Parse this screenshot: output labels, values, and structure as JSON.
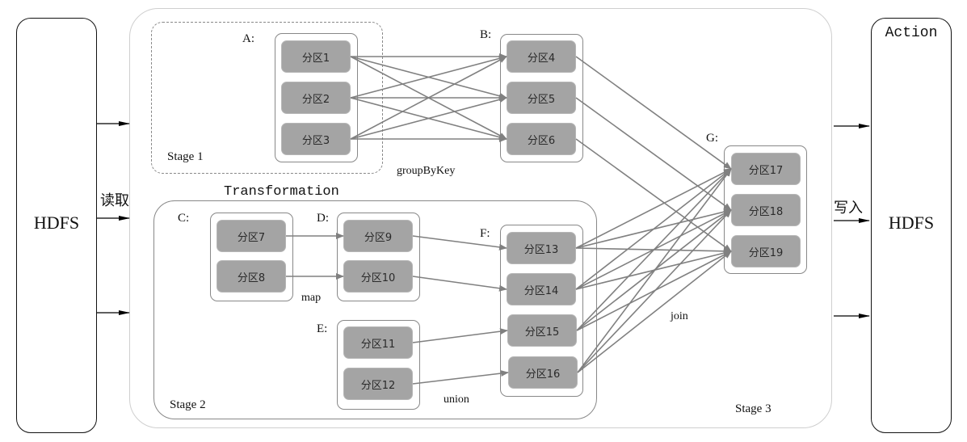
{
  "source": {
    "label": "HDFS",
    "read_label": "读取"
  },
  "sink": {
    "label": "HDFS",
    "header": "Action",
    "write_label": "写入"
  },
  "transformation_label": "Transformation",
  "stages": [
    {
      "id": "stage1",
      "label": "Stage 1"
    },
    {
      "id": "stage2",
      "label": "Stage 2"
    },
    {
      "id": "stage3",
      "label": "Stage 3"
    }
  ],
  "rdds": {
    "A": {
      "label": "A:",
      "partitions": [
        "分区1",
        "分区2",
        "分区3"
      ]
    },
    "B": {
      "label": "B:",
      "partitions": [
        "分区4",
        "分区5",
        "分区6"
      ]
    },
    "C": {
      "label": "C:",
      "partitions": [
        "分区7",
        "分区8"
      ]
    },
    "D": {
      "label": "D:",
      "partitions": [
        "分区9",
        "分区10"
      ]
    },
    "E": {
      "label": "E:",
      "partitions": [
        "分区11",
        "分区12"
      ]
    },
    "F": {
      "label": "F:",
      "partitions": [
        "分区13",
        "分区14",
        "分区15",
        "分区16"
      ]
    },
    "G": {
      "label": "G:",
      "partitions": [
        "分区17",
        "分区18",
        "分区19"
      ]
    }
  },
  "operations": {
    "groupByKey": "groupByKey",
    "map": "map",
    "union": "union",
    "join": "join"
  },
  "edges": [
    [
      "p1",
      "p4"
    ],
    [
      "p1",
      "p5"
    ],
    [
      "p1",
      "p6"
    ],
    [
      "p2",
      "p4"
    ],
    [
      "p2",
      "p5"
    ],
    [
      "p2",
      "p6"
    ],
    [
      "p3",
      "p4"
    ],
    [
      "p3",
      "p5"
    ],
    [
      "p3",
      "p6"
    ],
    [
      "p7",
      "p9"
    ],
    [
      "p8",
      "p10"
    ],
    [
      "p9",
      "p13"
    ],
    [
      "p10",
      "p14"
    ],
    [
      "p11",
      "p15"
    ],
    [
      "p12",
      "p16"
    ],
    [
      "p4",
      "p17"
    ],
    [
      "p5",
      "p18"
    ],
    [
      "p6",
      "p19"
    ],
    [
      "p13",
      "p17"
    ],
    [
      "p13",
      "p18"
    ],
    [
      "p13",
      "p19"
    ],
    [
      "p14",
      "p17"
    ],
    [
      "p14",
      "p18"
    ],
    [
      "p14",
      "p19"
    ],
    [
      "p15",
      "p17"
    ],
    [
      "p15",
      "p18"
    ],
    [
      "p15",
      "p19"
    ],
    [
      "p16",
      "p17"
    ],
    [
      "p16",
      "p18"
    ],
    [
      "p16",
      "p19"
    ]
  ],
  "colors": {
    "partition_fill": "#a4a4a4",
    "edge": "#808080",
    "io_arrow": "#000000"
  }
}
